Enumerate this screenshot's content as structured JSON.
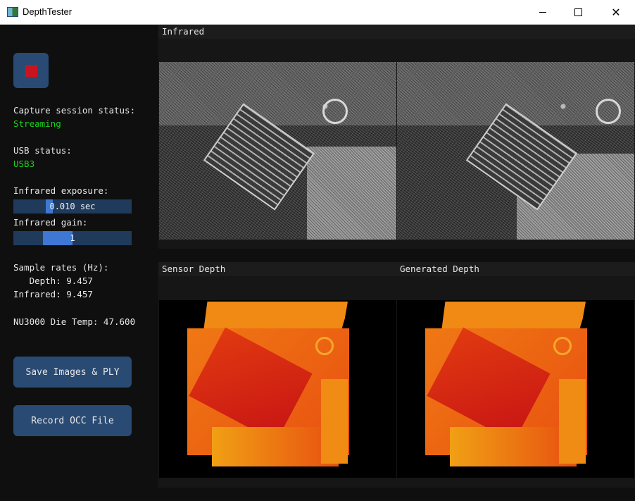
{
  "window": {
    "title": "DepthTester",
    "min_label": "",
    "max_label": "",
    "close_label": "✕"
  },
  "sidebar": {
    "capture_status_label": "Capture session status:",
    "capture_status_value": "Streaming",
    "usb_status_label": "USB status:",
    "usb_status_value": "USB3",
    "ir_exposure_label": "Infrared exposure:",
    "ir_exposure_value": "0.010 sec",
    "ir_exposure_fraction": 0.28,
    "ir_gain_label": "Infrared gain:",
    "ir_gain_value": "1",
    "ir_gain_fraction": 0.5,
    "sample_rates_label": "Sample rates (Hz):",
    "depth_rate": "   Depth: 9.457",
    "infrared_rate": "Infrared: 9.457",
    "die_temp": "NU3000 Die Temp: 47.600",
    "save_button": "Save Images & PLY",
    "record_button": "Record OCC File"
  },
  "panels": {
    "infrared_title": "Infrared",
    "sensor_depth_title": "Sensor Depth",
    "generated_depth_title": "Generated Depth"
  },
  "colors": {
    "accent_button": "#294a73",
    "slider_fill": "#3f78d4",
    "status_green": "#19d219",
    "stop_red": "#c8141e"
  }
}
